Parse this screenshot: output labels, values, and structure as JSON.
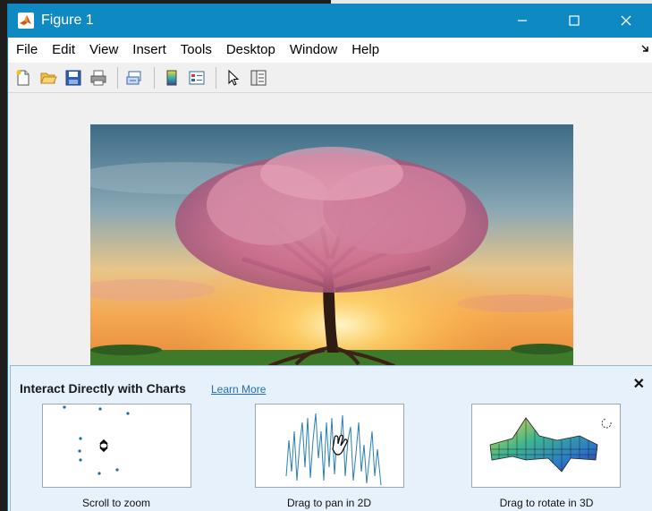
{
  "window": {
    "title": "Figure 1",
    "controls": {
      "minimize": "—",
      "maximize": "☐",
      "close": "✕"
    }
  },
  "menu": {
    "items": [
      "File",
      "Edit",
      "View",
      "Insert",
      "Tools",
      "Desktop",
      "Window",
      "Help"
    ]
  },
  "toolbar": {
    "buttons": [
      "new-figure-icon",
      "open-file-icon",
      "save-icon",
      "print-icon",
      "link-plot-icon",
      "colorbar-icon",
      "legend-icon",
      "pointer-icon",
      "property-inspector-icon"
    ]
  },
  "figure": {
    "image_subject": "tree-at-sunset"
  },
  "interact_panel": {
    "title": "Interact Directly with Charts",
    "link": "Learn More",
    "close": "✕",
    "cards": [
      {
        "caption": "Scroll to zoom",
        "icon": "scroll-zoom-icon"
      },
      {
        "caption": "Drag to pan in 2D",
        "icon": "pan-hand-icon"
      },
      {
        "caption": "Drag to rotate in 3D",
        "icon": "rotate-icon"
      }
    ]
  },
  "colors": {
    "titlebar": "#0f89c2",
    "panel_bg": "#e6f1fb",
    "link": "#1e6fbf"
  }
}
